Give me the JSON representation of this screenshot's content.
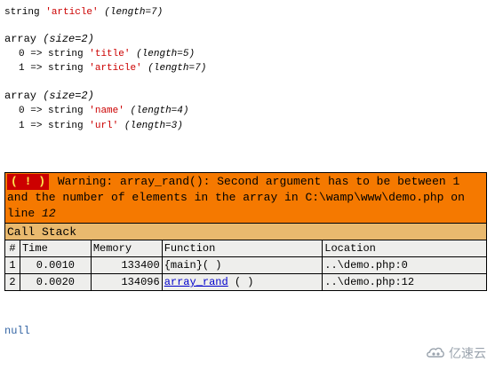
{
  "dump1": {
    "type": "string",
    "value": "'article'",
    "meta": "(length=7)"
  },
  "dump2": {
    "type": "array",
    "meta": "(size=2)",
    "items": [
      {
        "key": "0",
        "arrow": "=>",
        "type": "string",
        "value": "'title'",
        "meta": "(length=5)"
      },
      {
        "key": "1",
        "arrow": "=>",
        "type": "string",
        "value": "'article'",
        "meta": "(length=7)"
      }
    ]
  },
  "dump3": {
    "type": "array",
    "meta": "(size=2)",
    "items": [
      {
        "key": "0",
        "arrow": "=>",
        "type": "string",
        "value": "'name'",
        "meta": "(length=4)"
      },
      {
        "key": "1",
        "arrow": "=>",
        "type": "string",
        "value": "'url'",
        "meta": "(length=3)"
      }
    ]
  },
  "error": {
    "badge": "( ! )",
    "message_prefix": " Warning: array_rand(): Second argument has to be between 1 and the number of elements in the array in C:\\wamp\\www\\demo.php on line ",
    "line": "12",
    "call_stack_title": "Call Stack",
    "columns": [
      "#",
      "Time",
      "Memory",
      "Function",
      "Location"
    ],
    "rows": [
      {
        "num": "1",
        "time": "0.0010",
        "memory": "133400",
        "function": "{main}( )",
        "function_link": "",
        "function_suffix": "",
        "location": "..\\demo.php:0"
      },
      {
        "num": "2",
        "time": "0.0020",
        "memory": "134096",
        "function": "",
        "function_link": "array_rand",
        "function_suffix": " ( )",
        "location": "..\\demo.php:12"
      }
    ]
  },
  "null_output": "null",
  "watermark": {
    "text": "亿速云",
    "icon": "cloud-logo-icon"
  },
  "colors": {
    "string_value": "#cc0000",
    "warning_bg": "#f57900",
    "badge_bg": "#cc0000",
    "badge_fg": "#fce94f",
    "callstack_bg": "#e9b96e",
    "row_bg": "#eeeeec",
    "null_color": "#3465a4",
    "link": "#0000cc"
  }
}
